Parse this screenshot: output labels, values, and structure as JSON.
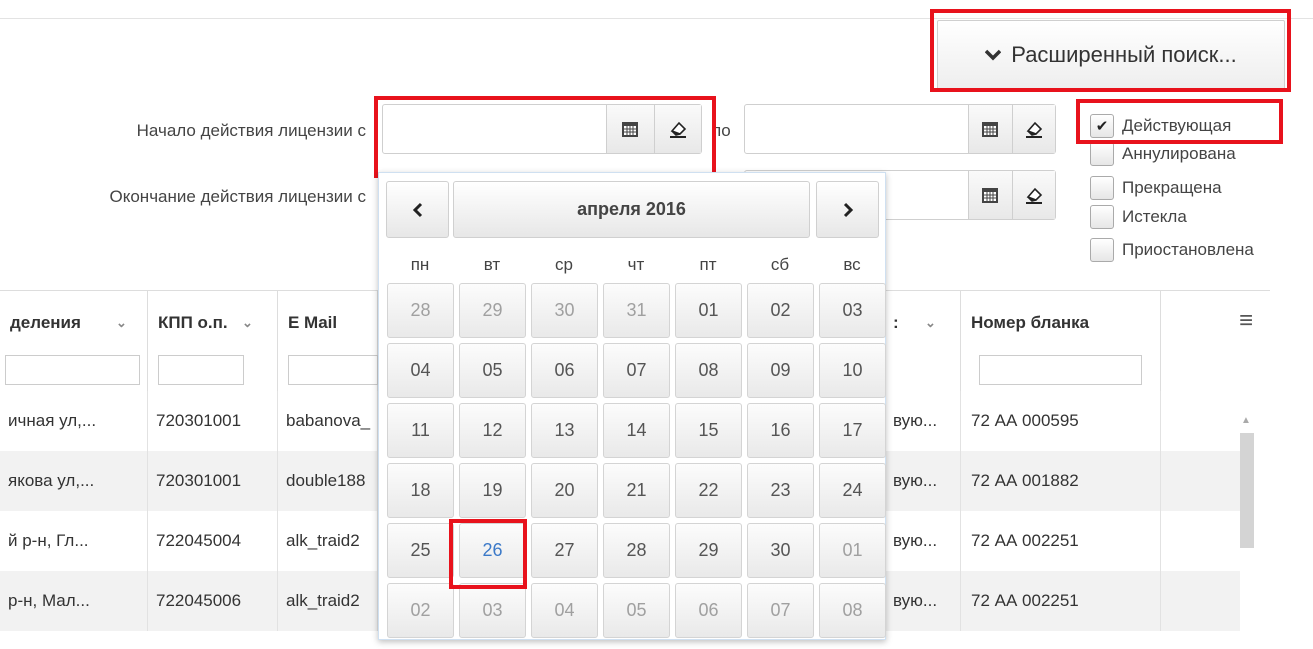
{
  "advanced_search": {
    "label": "Расширенный поиск...",
    "icon": "chevron-down-icon"
  },
  "filters": {
    "start_from_label": "Начало действия лицензии с",
    "end_from_label": "Окончание действия лицензии с",
    "to_label": "по",
    "calendar_icon": "calendar-icon",
    "clear_icon": "eraser-icon"
  },
  "statuses": [
    {
      "label": "Действующая",
      "checked": true
    },
    {
      "label": "Аннулирована",
      "checked": false
    },
    {
      "label": "Прекращена",
      "checked": false
    },
    {
      "label": "Истекла",
      "checked": false
    },
    {
      "label": "Приостановлена",
      "checked": false
    }
  ],
  "calendar": {
    "prev": "‹",
    "next": "›",
    "month_title": "апреля 2016",
    "weekdays": [
      "пн",
      "вт",
      "ср",
      "чт",
      "пт",
      "сб",
      "вс"
    ],
    "weeks": [
      [
        "28",
        "29",
        "30",
        "31",
        "01",
        "02",
        "03"
      ],
      [
        "04",
        "05",
        "06",
        "07",
        "08",
        "09",
        "10"
      ],
      [
        "11",
        "12",
        "13",
        "14",
        "15",
        "16",
        "17"
      ],
      [
        "18",
        "19",
        "20",
        "21",
        "22",
        "23",
        "24"
      ],
      [
        "25",
        "26",
        "27",
        "28",
        "29",
        "30",
        "01"
      ],
      [
        "02",
        "03",
        "04",
        "05",
        "06",
        "07",
        "08"
      ]
    ],
    "today": "26"
  },
  "table": {
    "columns": [
      "деления",
      "КПП о.п.",
      "E Mail",
      "Номер бланка"
    ],
    "rows": [
      {
        "address": "ичная ул,...",
        "kpp": "720301001",
        "email": "babanova_",
        "status": "вую...",
        "blank": "72 АА 000595"
      },
      {
        "address": "якова ул,...",
        "kpp": "720301001",
        "email": "double188",
        "status": "вую...",
        "blank": "72 АА 001882"
      },
      {
        "address": "й р-н, Гл...",
        "kpp": "722045004",
        "email": "alk_traid2",
        "status": "вую...",
        "blank": "72 АА 002251"
      },
      {
        "address": "р-н, Мал...",
        "kpp": "722045006",
        "email": "alk_traid2",
        "status": "вую...",
        "blank": "72 АА 002251"
      }
    ],
    "menu_icon": "hamburger-menu-icon"
  }
}
